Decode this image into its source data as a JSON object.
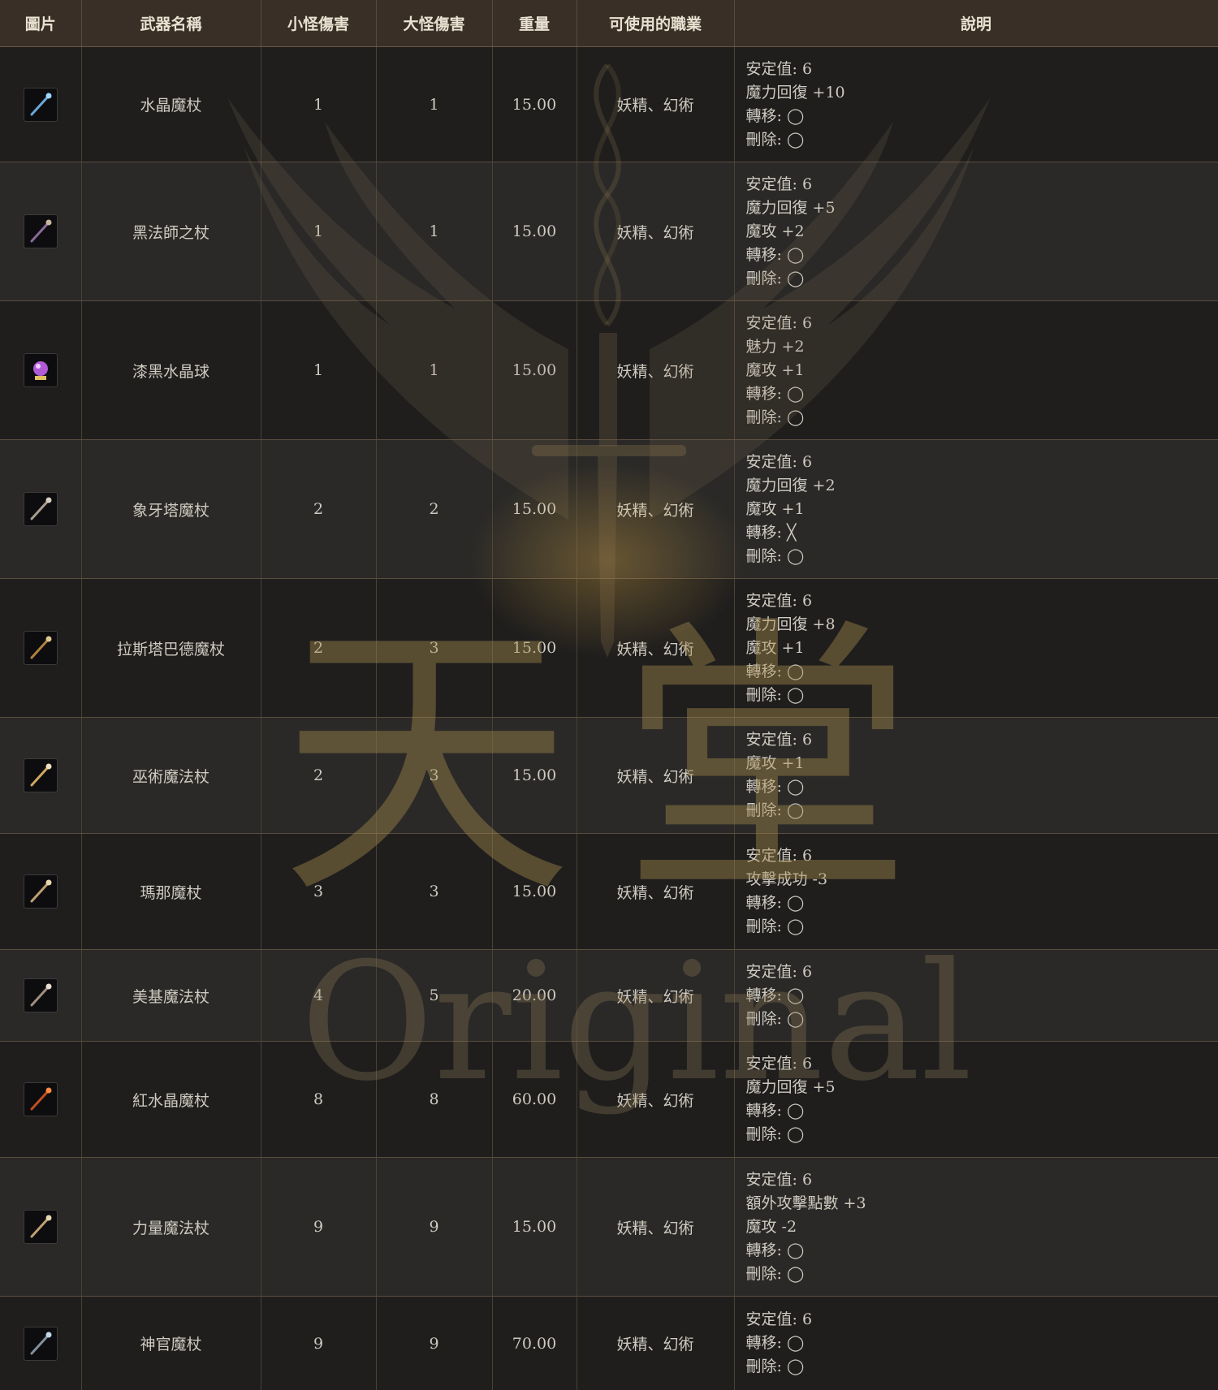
{
  "table": {
    "headers": [
      "圖片",
      "武器名稱",
      "小怪傷害",
      "大怪傷害",
      "重量",
      "可使用的職業",
      "說明"
    ],
    "rows": [
      {
        "icon": "crystal-staff-icon",
        "name": "水晶魔杖",
        "small": "1",
        "large": "1",
        "weight": "15.00",
        "classes": "妖精、幻術",
        "desc": [
          "安定值: 6",
          "魔力回復 +10",
          "轉移: ◯",
          "刪除: ◯"
        ]
      },
      {
        "icon": "dark-mage-staff-icon",
        "name": "黑法師之杖",
        "small": "1",
        "large": "1",
        "weight": "15.00",
        "classes": "妖精、幻術",
        "desc": [
          "安定值: 6",
          "魔力回復 +5",
          "魔攻 +2",
          "轉移: ◯",
          "刪除: ◯"
        ]
      },
      {
        "icon": "black-crystal-ball-icon",
        "name": "漆黑水晶球",
        "small": "1",
        "large": "1",
        "weight": "15.00",
        "classes": "妖精、幻術",
        "desc": [
          "安定值: 6",
          "魅力 +2",
          "魔攻 +1",
          "轉移: ◯",
          "刪除: ◯"
        ]
      },
      {
        "icon": "ivory-tower-staff-icon",
        "name": "象牙塔魔杖",
        "small": "2",
        "large": "2",
        "weight": "15.00",
        "classes": "妖精、幻術",
        "desc": [
          "安定值: 6",
          "魔力回復 +2",
          "魔攻 +1",
          "轉移: ╳",
          "刪除: ◯"
        ]
      },
      {
        "icon": "lastabad-staff-icon",
        "name": "拉斯塔巴德魔杖",
        "small": "2",
        "large": "3",
        "weight": "15.00",
        "classes": "妖精、幻術",
        "desc": [
          "安定值: 6",
          "魔力回復 +8",
          "魔攻 +1",
          "轉移: ◯",
          "刪除: ◯"
        ]
      },
      {
        "icon": "sorcery-staff-icon",
        "name": "巫術魔法杖",
        "small": "2",
        "large": "3",
        "weight": "15.00",
        "classes": "妖精、幻術",
        "desc": [
          "安定值: 6",
          "魔攻 +1",
          "轉移: ◯",
          "刪除: ◯"
        ]
      },
      {
        "icon": "mana-staff-icon",
        "name": "瑪那魔杖",
        "small": "3",
        "large": "3",
        "weight": "15.00",
        "classes": "妖精、幻術",
        "desc": [
          "安定值: 6",
          "攻擊成功 -3",
          "轉移: ◯",
          "刪除: ◯"
        ]
      },
      {
        "icon": "meki-staff-icon",
        "name": "美基魔法杖",
        "small": "4",
        "large": "5",
        "weight": "20.00",
        "classes": "妖精、幻術",
        "desc": [
          "安定值: 6",
          "轉移: ◯",
          "刪除: ◯"
        ]
      },
      {
        "icon": "red-crystal-staff-icon",
        "name": "紅水晶魔杖",
        "small": "8",
        "large": "8",
        "weight": "60.00",
        "classes": "妖精、幻術",
        "desc": [
          "安定值: 6",
          "魔力回復 +5",
          "轉移: ◯",
          "刪除: ◯"
        ]
      },
      {
        "icon": "power-staff-icon",
        "name": "力量魔法杖",
        "small": "9",
        "large": "9",
        "weight": "15.00",
        "classes": "妖精、幻術",
        "desc": [
          "安定值: 6",
          "額外攻擊點數 +3",
          "魔攻 -2",
          "轉移: ◯",
          "刪除: ◯"
        ]
      },
      {
        "icon": "priest-staff-icon",
        "name": "神官魔杖",
        "small": "9",
        "large": "9",
        "weight": "70.00",
        "classes": "妖精、幻術",
        "desc": [
          "安定值: 6",
          "轉移: ◯",
          "刪除: ◯"
        ]
      }
    ]
  },
  "watermark": {
    "title": "天堂",
    "subtitle": "Original"
  },
  "colors": {
    "header_bg": "#3a2f26",
    "row_odd": "#1f1e1d",
    "row_even": "#2a2927",
    "watermark_gold": "#a88c4e"
  }
}
